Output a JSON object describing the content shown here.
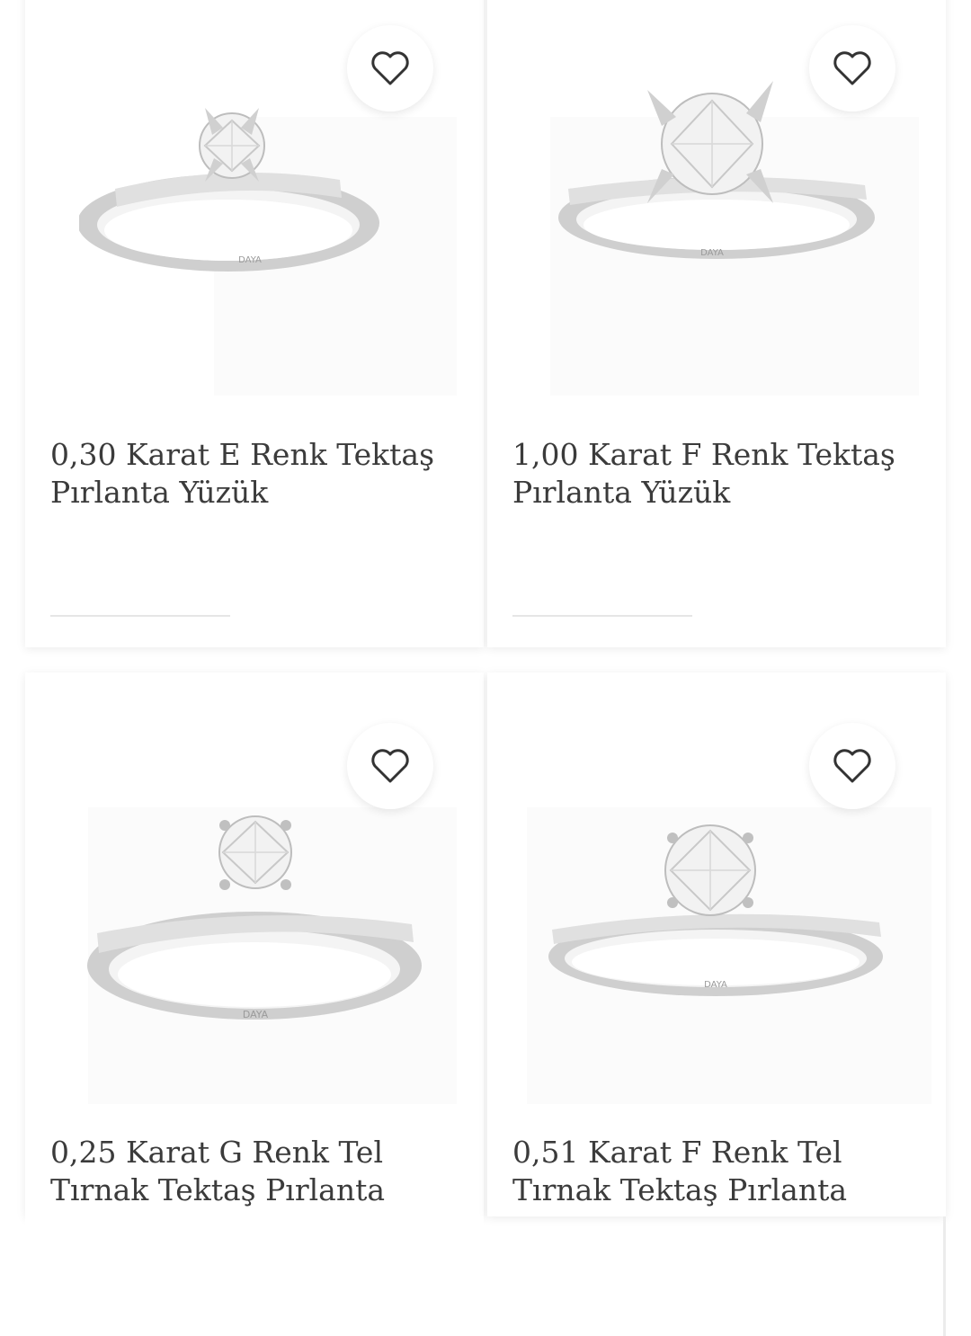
{
  "products": [
    {
      "title": "0,30 Karat E Renk Tektaş Pırlanta Yüzük",
      "brand": "DAYA",
      "icon": "heart-outline-icon"
    },
    {
      "title": "1,00 Karat F Renk Tektaş Pırlanta Yüzük",
      "brand": "DAYA",
      "icon": "heart-outline-icon"
    },
    {
      "title": "0,25 Karat G Renk Tel Tırnak Tektaş Pırlanta",
      "brand": "DAYA",
      "icon": "heart-outline-icon"
    },
    {
      "title": "0,51 Karat F Renk Tel Tırnak Tektaş Pırlanta",
      "brand": "DAYA",
      "icon": "heart-outline-icon"
    }
  ],
  "colors": {
    "text": "#3b3b3b",
    "card_bg": "#ffffff",
    "metal": "#d8d8d8"
  }
}
